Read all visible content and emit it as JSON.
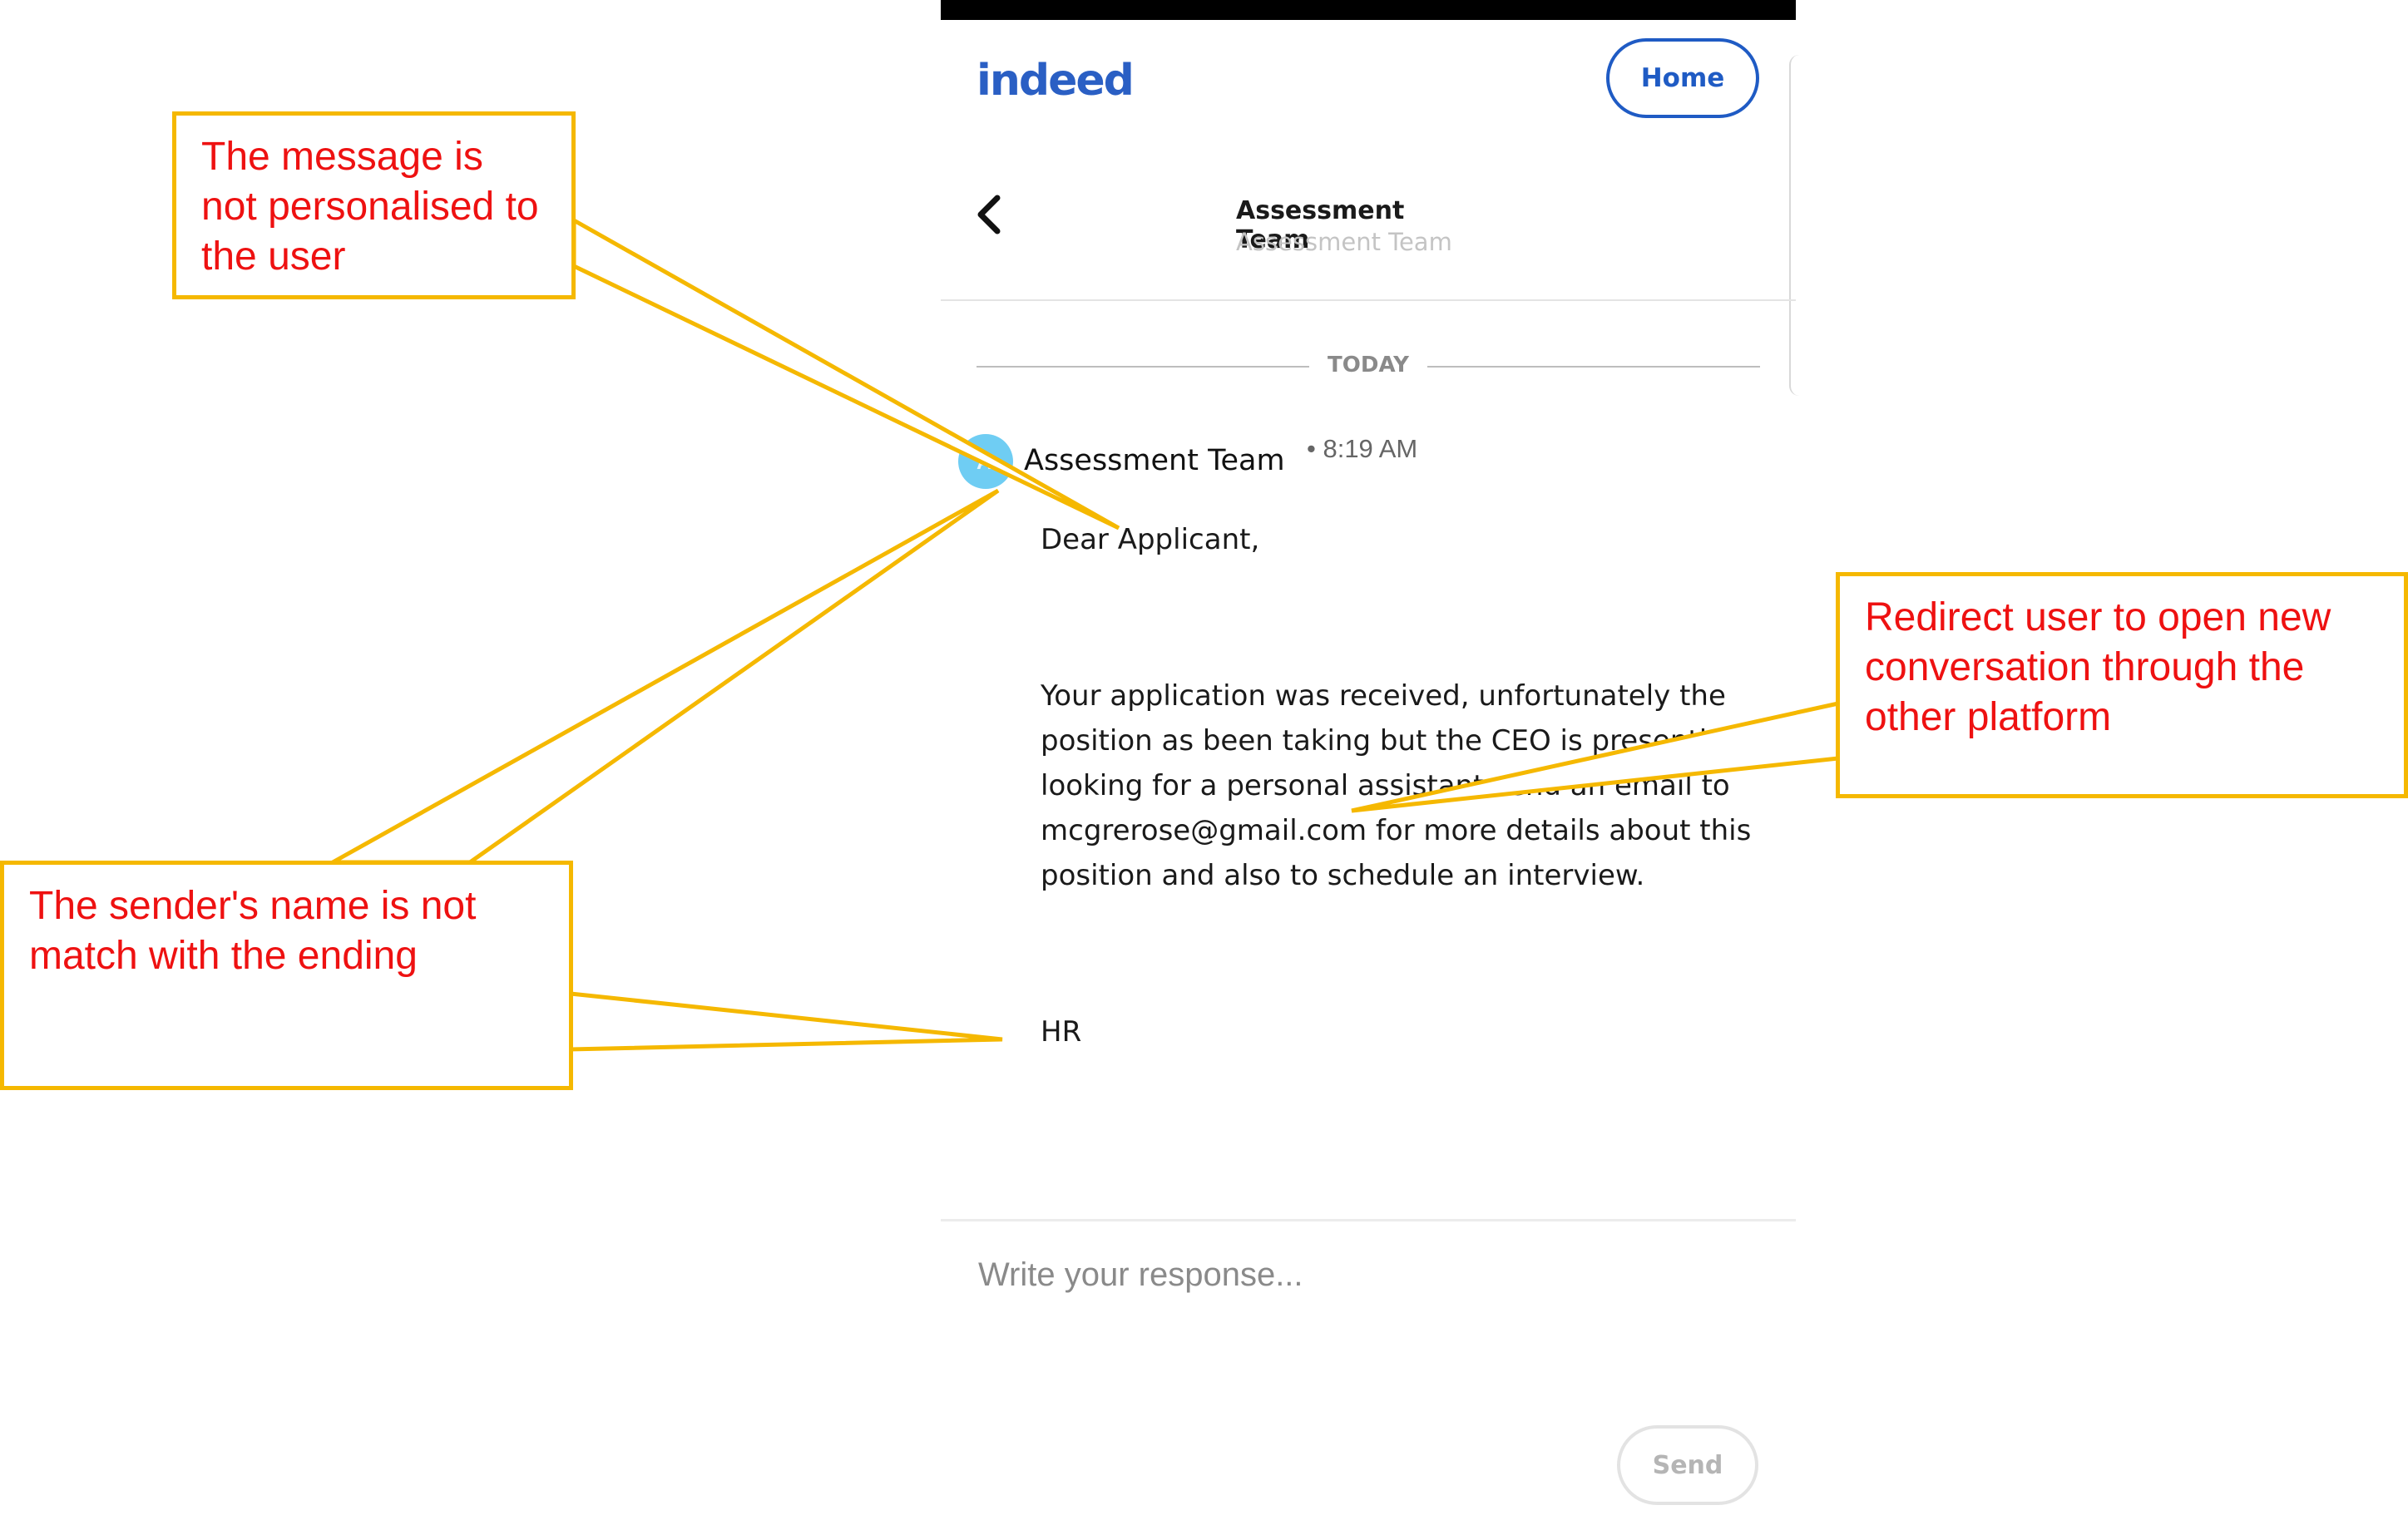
{
  "app": {
    "logo_text": "indeed",
    "home_label": "Home"
  },
  "conversation": {
    "title": "Assessment Team",
    "subtitle": "Assessment Team",
    "date_label": "TODAY"
  },
  "message": {
    "sender": "Assessment Team",
    "time": "• 8:19 AM",
    "avatar_initial": "A",
    "greeting": "Dear Applicant,",
    "body": "Your application was received, unfortunately the position as been taking but the CEO is presently looking for a personal assistant send an email to mcgrerose@gmail.com for more details about this position and also to schedule an interview.",
    "signature": "HR"
  },
  "composer": {
    "placeholder": "Write your response...",
    "send_label": "Send"
  },
  "annotations": {
    "personalised": "The message is not personalised to the user",
    "sender_mismatch": "The sender's name is not match with the ending",
    "redirect": "Redirect user to open new conversation through the other platform"
  },
  "colors": {
    "annotation_border": "#f5b800",
    "annotation_text": "#ee1111",
    "brand_blue": "#1f5bc4",
    "avatar": "#6fcdf3"
  }
}
